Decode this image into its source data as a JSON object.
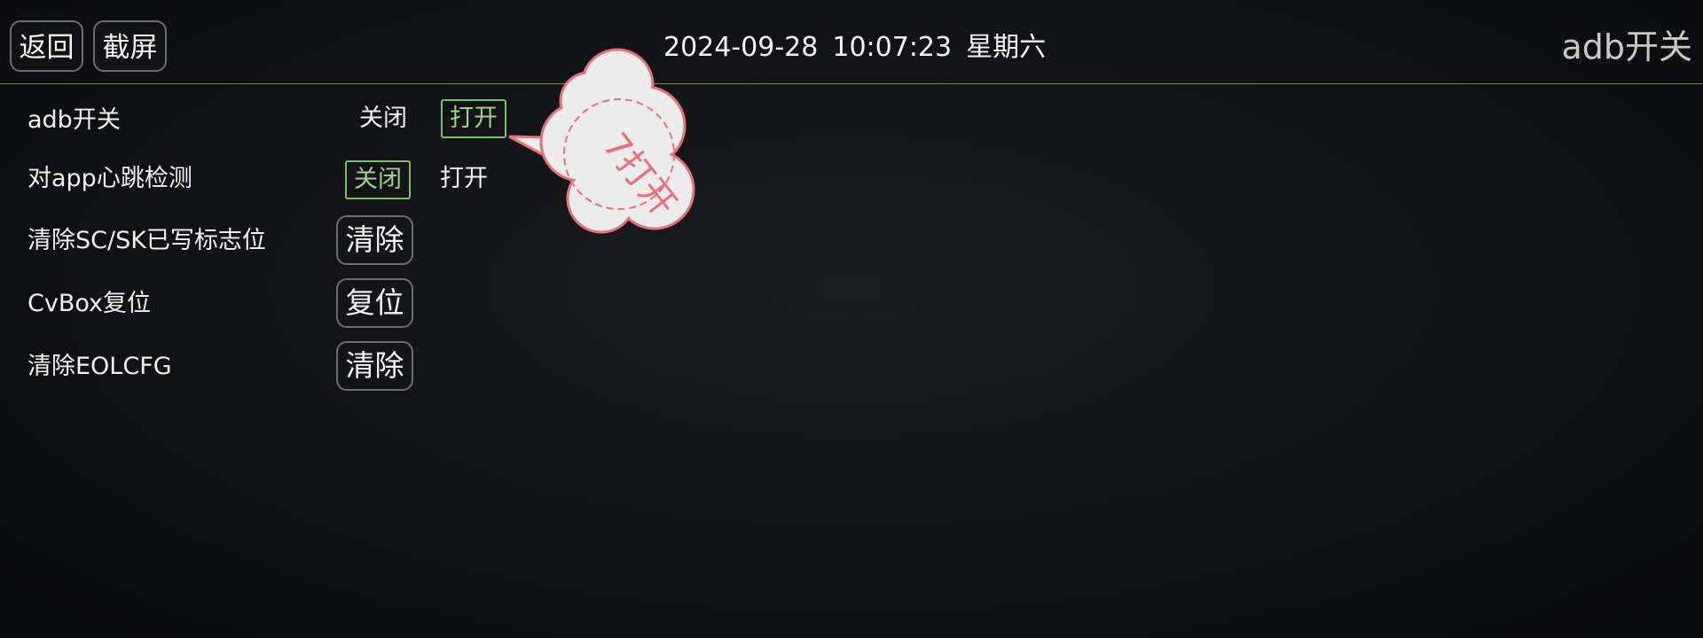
{
  "header": {
    "back_label": "返回",
    "screenshot_label": "截屏",
    "date": "2024-09-28",
    "time": "10:07:23",
    "weekday": "星期六",
    "page_title": "adb开关"
  },
  "rows": [
    {
      "label": "adb开关",
      "off_label": "关闭",
      "on_label": "打开",
      "selected": "打开"
    },
    {
      "label": "对app心跳检测",
      "off_label": "关闭",
      "on_label": "打开",
      "selected": "关闭"
    },
    {
      "label": "清除SC/SK已写标志位",
      "action_label": "清除"
    },
    {
      "label": "CvBox复位",
      "action_label": "复位"
    },
    {
      "label": "清除EOLCFG",
      "action_label": "清除"
    }
  ],
  "annotation": {
    "text": "7打开",
    "fill_color": "#ececec",
    "stroke_color": "#e8707a"
  },
  "colors": {
    "selected_border": "#7fbf6c",
    "selected_text": "#9fd38d",
    "divider": "#8a7a4a"
  }
}
